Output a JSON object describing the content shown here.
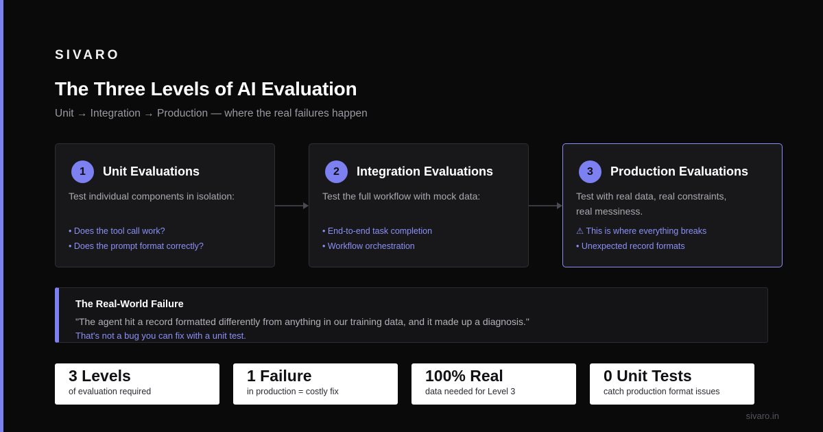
{
  "brand": "SIVARO",
  "title": "The Three Levels of AI Evaluation",
  "subtitle": "Unit → Integration → Production — where the real failures happen",
  "colors": {
    "accent": "#7c80f0",
    "background": "#0a0a0b",
    "card": "#18181b"
  },
  "levels": [
    {
      "number": "1",
      "title": "Unit Evaluations",
      "description": "Test individual components in isolation:",
      "points": [
        "• Does the tool call work?",
        "• Does the prompt format correctly?"
      ],
      "highlighted": false
    },
    {
      "number": "2",
      "title": "Integration Evaluations",
      "description": "Test the full workflow with mock data:",
      "points": [
        "• End-to-end task completion",
        "• Workflow orchestration"
      ],
      "highlighted": false
    },
    {
      "number": "3",
      "title": "Production Evaluations",
      "description": "Test with real data, real constraints, real messiness.",
      "points": [
        "⚠ This is where everything breaks",
        "• Unexpected record formats"
      ],
      "highlighted": true
    }
  ],
  "failure": {
    "heading": "The Real-World Failure",
    "quote": "\"The agent hit a record formatted differently from anything in our training data, and it made up a diagnosis.\"",
    "note": "That's not a bug you can fix with a unit test."
  },
  "stats": [
    {
      "value": "3 Levels",
      "label": "of evaluation required"
    },
    {
      "value": "1 Failure",
      "label": "in production = costly fix"
    },
    {
      "value": "100% Real",
      "label": "data needed for Level 3"
    },
    {
      "value": "0 Unit Tests",
      "label": "catch production format issues"
    }
  ],
  "footer": "sivaro.in"
}
